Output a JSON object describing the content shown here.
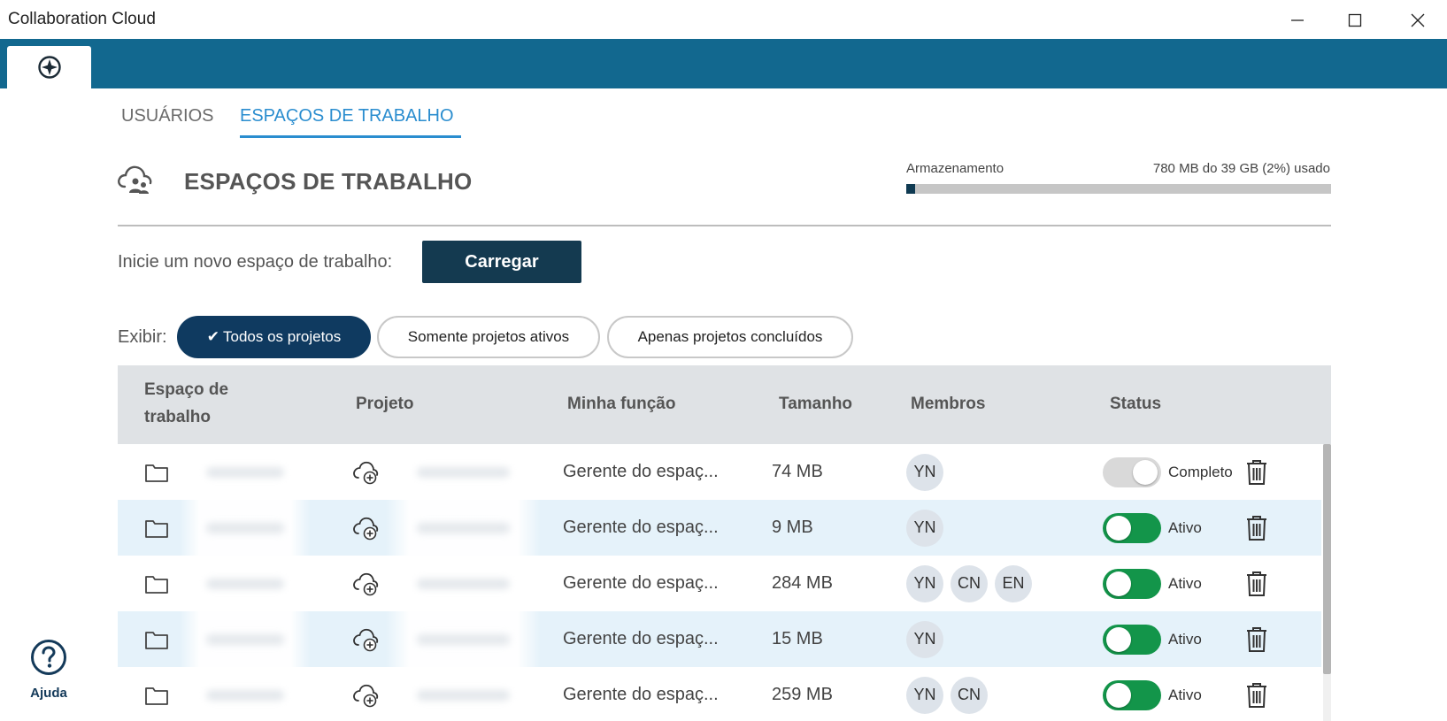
{
  "window": {
    "title": "Collaboration Cloud"
  },
  "tabs": {
    "users": "USUÁRIOS",
    "workspaces": "ESPAÇOS DE TRABALHO"
  },
  "header": {
    "title": "ESPAÇOS DE TRABALHO"
  },
  "storage": {
    "label": "Armazenamento",
    "value": "780 MB do 39 GB (2%) usado",
    "used_fraction": 0.02
  },
  "new_workspace": {
    "label": "Inicie um novo espaço de trabalho:",
    "button": "Carregar"
  },
  "filter": {
    "label": "Exibir:",
    "options": [
      "Todos os projetos",
      "Somente projetos ativos",
      "Apenas projetos concluídos"
    ],
    "selected": 0
  },
  "table": {
    "columns": {
      "workspace_line1": "Espaço de",
      "workspace_line2": "trabalho",
      "project": "Projeto",
      "role": "Minha função",
      "size": "Tamanho",
      "members": "Membros",
      "status": "Status"
    },
    "rows": [
      {
        "role": "Gerente do espaç...",
        "size": "74 MB",
        "members": [
          "YN"
        ],
        "status": "Completo",
        "active": false
      },
      {
        "role": "Gerente do espaç...",
        "size": "9 MB",
        "members": [
          "YN"
        ],
        "status": "Ativo",
        "active": true
      },
      {
        "role": "Gerente do espaç...",
        "size": "284 MB",
        "members": [
          "YN",
          "CN",
          "EN"
        ],
        "status": "Ativo",
        "active": true
      },
      {
        "role": "Gerente do espaç...",
        "size": "15 MB",
        "members": [
          "YN"
        ],
        "status": "Ativo",
        "active": true
      },
      {
        "role": "Gerente do espaç...",
        "size": "259 MB",
        "members": [
          "YN",
          "CN"
        ],
        "status": "Ativo",
        "active": true
      }
    ]
  },
  "help": {
    "label": "Ajuda"
  },
  "colors": {
    "appbar": "#12688f",
    "accent": "#2a8dcf",
    "dark_button": "#143a50",
    "toggle_on": "#13954a"
  }
}
